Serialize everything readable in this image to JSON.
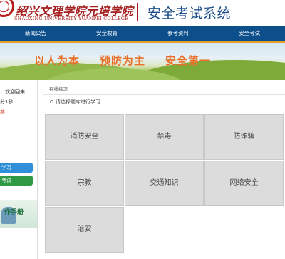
{
  "header": {
    "school_cn": "绍兴文理学院元培学院",
    "school_en": "SHAOXING UNIVERSITY  YUANPEI COLLEGE",
    "system_title": "安全考试系统"
  },
  "nav": [
    "新闻公告",
    "安全教育",
    "参考资料",
    "安全考试"
  ],
  "banner": {
    "slogans": [
      "以人为本",
      "预防为主",
      "安全第一"
    ]
  },
  "sidebar": {
    "welcome": "，欢迎回来",
    "elapsed": "分1秒",
    "warning": "禁",
    "learn_button": "学习",
    "exam_button": "考试",
    "manual_label": "作手册"
  },
  "main": {
    "breadcrumb": "在线练习",
    "hint": "请选择题库进行学习",
    "categories": [
      "消防安全",
      "禁毒",
      "防诈骗",
      "宗教",
      "交通知识",
      "网络安全",
      "治安"
    ]
  },
  "colors": {
    "nav_bg": "#0d4f8b",
    "title_blue": "#1b4c8c",
    "school_red": "#a51d1d",
    "slogan_orange": "#e8702a",
    "tile_bg": "#dcdcdc"
  }
}
